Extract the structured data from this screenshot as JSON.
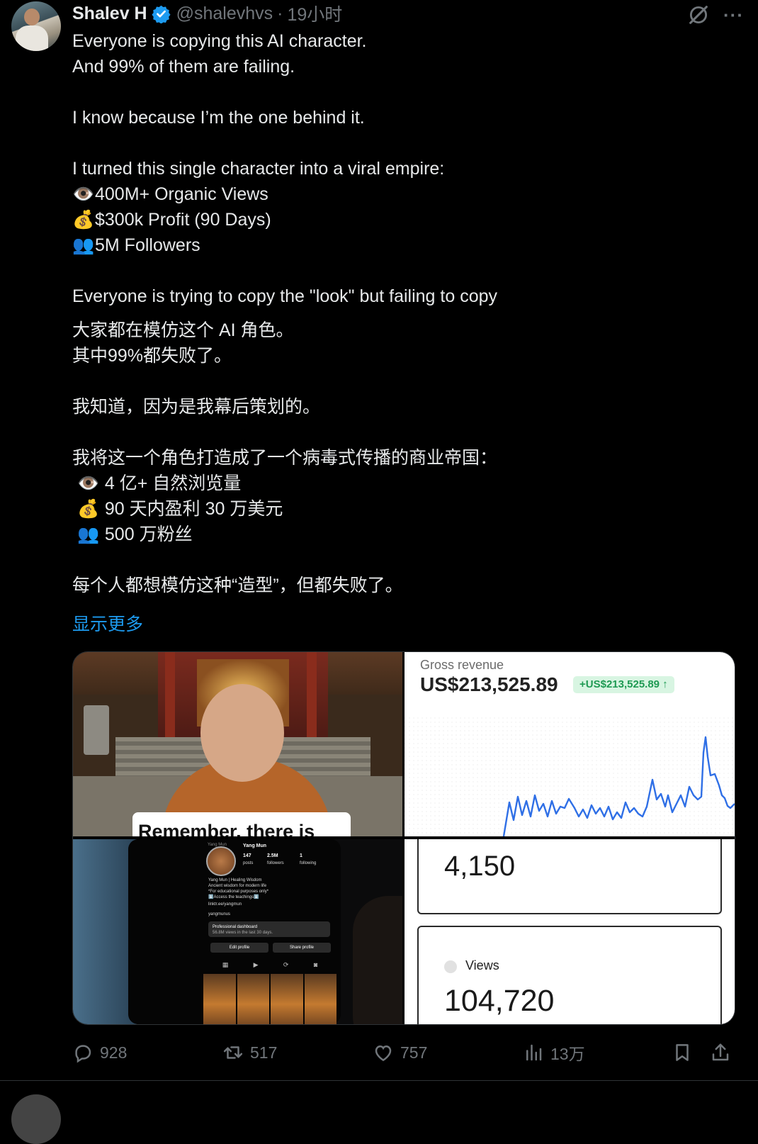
{
  "author": {
    "name": "Shalev H",
    "handle": "@shalevhvs",
    "separator": "·",
    "time": "19小时",
    "verified_color": "#1d9bf0"
  },
  "header_icons": {
    "grok": "grok-icon",
    "more": "more-icon",
    "more_glyph": "···"
  },
  "tweet": {
    "en_lines": [
      "Everyone is copying this AI character.",
      "And 99% of them are failing.",
      "I know because I’m the one behind it.",
      "I turned this single character into a viral empire:",
      "400M+ Organic Views",
      "$300k Profit (90 Days)",
      "5M Followers",
      "Everyone is trying to copy the \"look\" but failing to copy"
    ],
    "zh_lines": [
      "大家都在模仿这个 AI 角色。",
      "其中99%都失败了。",
      "我知道，因为是我幕后策划的。",
      "我将这一个角色打造成了一个病毒式传播的商业帝国：",
      "4 亿+ 自然浏览量",
      "90 天内盈利 30 万美元",
      "500 万粉丝",
      "每个人都想模仿这种“造型”，但都失败了。"
    ],
    "emoji": {
      "eye": "👁️",
      "money": "💰",
      "people": "👥"
    },
    "show_more": "显示更多",
    "link_color": "#1d9bf0"
  },
  "media": {
    "video_caption": "Remember, there is",
    "revenue": {
      "label": "Gross revenue",
      "value": "US$213,525.89",
      "change": "+US$213,525.89 ↑",
      "line_color": "#2f6fe6"
    },
    "profile_screen": {
      "name": "Yang Mun",
      "top_note": "Yang Mun",
      "posts": "147",
      "posts_label": "posts",
      "followers": "2.5M",
      "followers_label": "followers",
      "following": "1",
      "following_label": "following",
      "bio_lines": [
        "Yang Mun | Healing Wisdom",
        "Ancient wisdom for modern life",
        "*For educational purposes only*",
        "⬇️Access the teachings⬇️"
      ],
      "link": "linktr.ee/yangmun",
      "threads": "yangmunus",
      "dashboard_title": "Professional dashboard",
      "dashboard_sub": "56.8M views in the last 30 days.",
      "edit_profile": "Edit profile",
      "share_profile": "Share profile",
      "tab_icons": [
        "▦",
        "▶",
        "⟳",
        "◙"
      ]
    },
    "stat_value": "4,150",
    "views_label": "Views",
    "views_value": "104,720"
  },
  "actions": {
    "replies": "928",
    "reposts": "517",
    "likes": "757",
    "views": "13万"
  }
}
